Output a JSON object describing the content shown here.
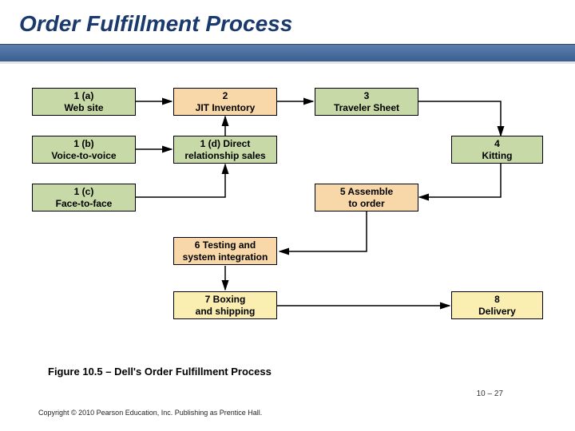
{
  "title": "Order Fulfillment Process",
  "boxes": {
    "b1a": "1 (a)\nWeb site",
    "b1b": "1 (b)\nVoice-to-voice",
    "b1c": "1 (c)\nFace-to-face",
    "b2": "2\nJIT Inventory",
    "b1d": "1 (d) Direct\nrelationship sales",
    "b3": "3\nTraveler Sheet",
    "b4": "4\nKitting",
    "b5": "5 Assemble\nto order",
    "b6": "6 Testing and\nsystem integration",
    "b7": "7 Boxing\nand shipping",
    "b8": "8\nDelivery"
  },
  "caption": "Figure 10.5 – Dell's Order Fulfillment Process",
  "pagenum": "10 – 27",
  "copyright": "Copyright © 2010 Pearson Education, Inc. Publishing as Prentice Hall."
}
